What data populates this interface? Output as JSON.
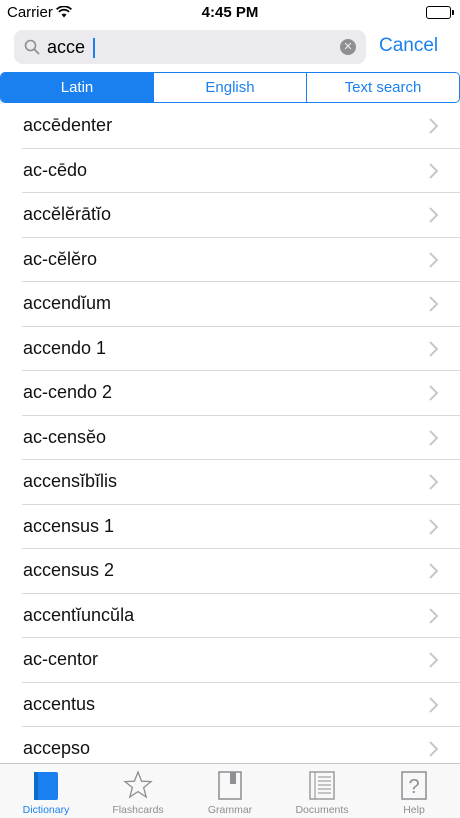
{
  "status_bar": {
    "carrier": "Carrier",
    "time": "4:45 PM"
  },
  "search": {
    "value": "acce",
    "cancel_label": "Cancel"
  },
  "segments": [
    {
      "label": "Latin",
      "selected": true
    },
    {
      "label": "English",
      "selected": false
    },
    {
      "label": "Text search",
      "selected": false
    }
  ],
  "results": [
    "accēdenter",
    "ac-cēdo",
    "accĕlĕrātĭo",
    "ac-cĕlĕro",
    "accendĭum",
    "accendo 1",
    "ac-cendo 2",
    "ac-censĕo",
    "accensĭbĭlis",
    "accensus 1",
    "accensus 2",
    "accentĭuncŭla",
    "ac-centor",
    "accentus",
    "accepso"
  ],
  "tabs": [
    {
      "label": "Dictionary",
      "icon": "book-icon",
      "active": true
    },
    {
      "label": "Flashcards",
      "icon": "star-icon",
      "active": false
    },
    {
      "label": "Grammar",
      "icon": "notebook-icon",
      "active": false
    },
    {
      "label": "Documents",
      "icon": "document-icon",
      "active": false
    },
    {
      "label": "Help",
      "icon": "question-icon",
      "active": false
    }
  ],
  "colors": {
    "accent": "#1a80f0",
    "inactive": "#8e8e93"
  }
}
